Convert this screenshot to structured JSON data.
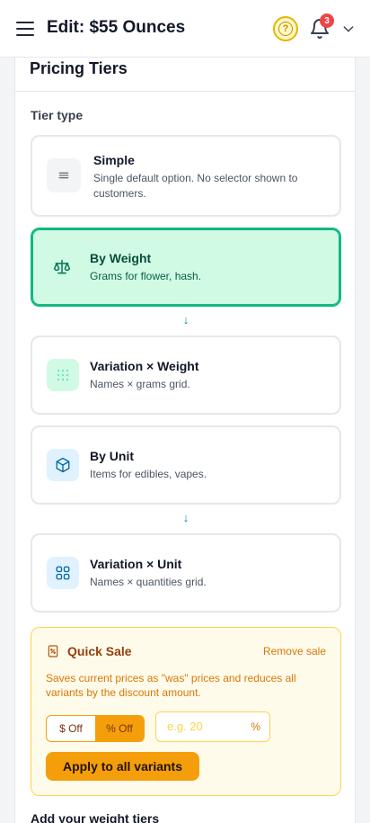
{
  "header": {
    "title": "Edit: $55 Ounces",
    "notifications_count": "3",
    "icons": {
      "menu": "hamburger-icon",
      "help": "question-icon",
      "bell": "bell-icon",
      "dropdown": "chevron-down-icon"
    },
    "colors": {
      "help_ring": "#eab308",
      "badge": "#ef4444"
    }
  },
  "card": {
    "title": "Pricing Tiers",
    "tier_type_label": "Tier type",
    "options": [
      {
        "name": "Simple",
        "description": "Single default option. No selector shown to customers.",
        "icon": "menu-lines-icon",
        "selected": false
      },
      {
        "name": "By Weight",
        "description": "Grams for flower, hash.",
        "icon": "scale-icon",
        "selected": true
      },
      {
        "name": "Variation × Weight",
        "description": "Names × grams grid.",
        "icon": "grid-dots-icon",
        "selected": false
      },
      {
        "name": "By Unit",
        "description": "Items for edibles, vapes.",
        "icon": "box-icon",
        "selected": false
      },
      {
        "name": "Variation × Unit",
        "description": "Names × quantities grid.",
        "icon": "grid-squares-icon",
        "selected": false
      }
    ],
    "arrows": [
      "↓",
      "↓"
    ],
    "colors": {
      "selected_border": "#10b981",
      "selected_bg": "#d1fae5"
    }
  },
  "quick_sale": {
    "title": "Quick Sale",
    "remove_label": "Remove sale",
    "description": "Saves current prices as \"was\" prices and reduces all variants by the discount amount.",
    "toggle": {
      "dollar_label": "$ Off",
      "percent_label": "% Off",
      "active": "percent"
    },
    "discount_placeholder": "e.g. 20",
    "discount_unit": "%",
    "apply_label": "Apply to all variants",
    "colors": {
      "accent": "#f59e0b",
      "bg": "#fffbeb",
      "text": "#d97706"
    }
  },
  "next_section": {
    "heading": "Add your weight tiers"
  }
}
